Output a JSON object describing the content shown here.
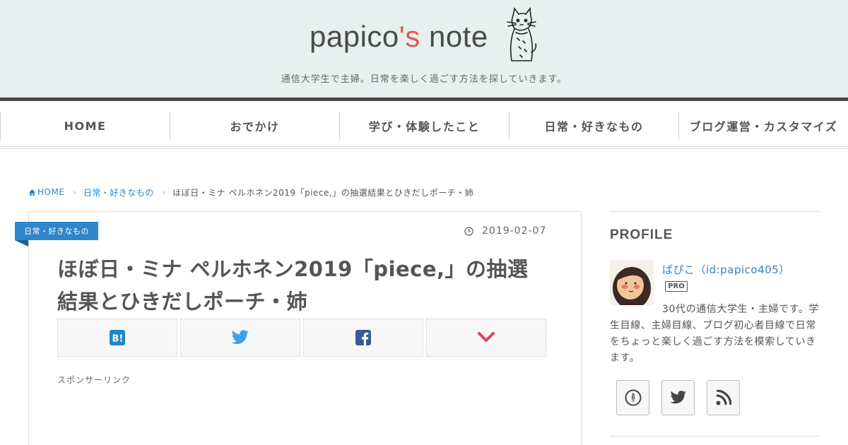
{
  "header": {
    "logo_main": "papico",
    "logo_accent": "'s",
    "logo_tail": " note",
    "tagline": "通信大学生で主婦。日常を楽しく過ごす方法を探していきます。"
  },
  "nav": {
    "items": [
      {
        "label": "HOME"
      },
      {
        "label": "おでかけ"
      },
      {
        "label": "学び・体験したこと"
      },
      {
        "label": "日常・好きなもの"
      },
      {
        "label": "ブログ運営・カスタマイズ"
      }
    ]
  },
  "breadcrumb": {
    "home": "HOME",
    "category": "日常・好きなもの",
    "current": "ほぼ日・ミナ ペルホネン2019「piece,」の抽選結果とひきだしポーチ・姉"
  },
  "article": {
    "category_label": "日常・好きなもの",
    "date": "2019-02-07",
    "title_line1": "ほぼ日・ミナ ペルホネン2019「piece,」の抽選",
    "title_line2": "結果とひきだしポーチ・姉",
    "sponsor_text": "スポンサーリンク"
  },
  "share": {
    "buttons": [
      {
        "icon": "hatena-bookmark-icon",
        "color": "#1e88c7"
      },
      {
        "icon": "twitter-icon",
        "color": "#3ea1ec"
      },
      {
        "icon": "facebook-icon",
        "color": "#3b5998"
      },
      {
        "icon": "pocket-icon",
        "color": "#e0405a"
      }
    ]
  },
  "sidebar": {
    "profile_title": "PROFILE",
    "profile_name": "ぱぴこ（id:papico405）",
    "pro_badge": "PRO",
    "profile_desc_line1": "30代の通信大学生・主婦です。",
    "profile_desc_rest": "学生目線、主婦目線、ブログ初心者目線で日常をちょっと楽しく過ごす方法を模索していきます。",
    "social": [
      {
        "icon": "hatena-blog-icon"
      },
      {
        "icon": "twitter-icon"
      },
      {
        "icon": "rss-icon"
      }
    ]
  },
  "colors": {
    "header_bg": "#e6f0ee",
    "accent_red": "#e05a5a",
    "link_blue": "#2f86c9",
    "text_gray": "#555555"
  }
}
